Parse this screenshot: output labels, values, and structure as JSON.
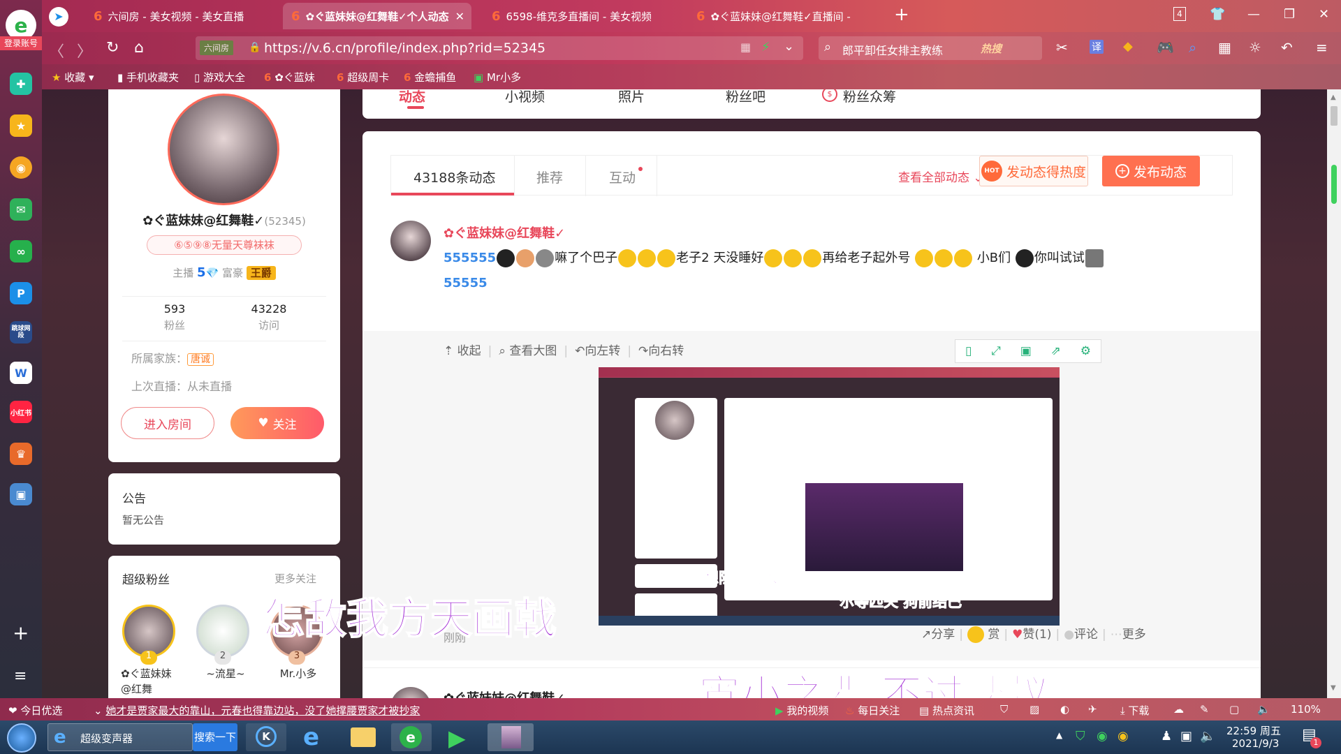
{
  "sidebar": {
    "login_label": "登录账号",
    "icons": [
      "browser-logo-icon",
      "plus-app-icon",
      "star-app-icon",
      "weibo-icon",
      "mail-icon",
      "link-icon",
      "p-app-icon",
      "game-app-icon",
      "doc-icon",
      "redbook-icon",
      "game-icon",
      "photo-icon"
    ],
    "redbook_label": "小红书",
    "game_label": "跳球网段",
    "add_label": "+",
    "menu_label": "≡"
  },
  "tabs": [
    {
      "label": "六间房 - 美女视频 - 美女直播",
      "active": false
    },
    {
      "label": "✿ぐ蓝妹妹@红舞鞋✓个人动态",
      "active": true
    },
    {
      "label": "6598-维克多直播间 - 美女视频",
      "active": false
    },
    {
      "label": "✿ぐ蓝妹妹@红舞鞋✓直播间 -",
      "active": false
    }
  ],
  "tab_count": "4",
  "navbar": {
    "site_tag": "六间房",
    "url": "https://v.6.cn/profile/index.php?rid=52345",
    "search_text": "郎平卸任女排主教练",
    "hot_label": "热搜"
  },
  "bookmarks": [
    "收藏",
    "手机收藏夹",
    "游戏大全",
    "✿ぐ蓝妹",
    "超级周卡",
    "金蟾捕鱼",
    "Mr小多"
  ],
  "profile": {
    "name": "✿ぐ蓝妹妹@红舞鞋✓",
    "rid": "(52345)",
    "badge": "⑥⑤⑨⑧无量天尊袜袜",
    "anchor_label": "主播",
    "anchor_level": "5",
    "rich_label": "富豪",
    "rich_level": "王爵",
    "fans_count": "593",
    "fans_label": "粉丝",
    "visit_count": "43228",
    "visit_label": "访问",
    "family_label": "所属家族：",
    "family_value": "唐诚",
    "last_live": "上次直播：从未直播",
    "enter_room": "进入房间",
    "follow": "关注"
  },
  "notice": {
    "title": "公告",
    "text": "暂无公告"
  },
  "super_fans": {
    "title": "超级粉丝",
    "more": "更多关注",
    "fans": [
      {
        "rank": "1",
        "name": "✿ぐ蓝妹妹@红舞"
      },
      {
        "rank": "2",
        "name": "~流星~"
      },
      {
        "rank": "3",
        "name": "Mr.小多"
      }
    ]
  },
  "top_nav": [
    "动态",
    "小视频",
    "照片",
    "粉丝吧",
    "粉丝众筹"
  ],
  "feed": {
    "tabs": [
      "43188条动态",
      "推荐",
      "互动"
    ],
    "view_all": "查看全部动态",
    "heat_button": "发动态得热度",
    "post_button": "发布动态",
    "hot_badge": "HOT",
    "post_author": "✿ぐ蓝妹妹@红舞鞋✓",
    "post_text_1": "嘛了个巴子",
    "post_text_2": "老子2 天没睡好",
    "post_text_3": "再给老子起外号",
    "post_text_4": "小B们",
    "post_text_5": "你叫试试",
    "img_tools": [
      "收起",
      "查看大图",
      "向左转",
      "向右转"
    ],
    "time": "刚刚",
    "actions": [
      "分享",
      "赏",
      "赞(1)",
      "评论",
      "更多"
    ],
    "next_author": "✿ぐ蓝妹妹@红舞鞋✓"
  },
  "screenshot_overlays": [
    "妄想阻挡我入城",
    "尔等匹夫 狗前结巴"
  ],
  "overlays": [
    "怎敌我方天画戟",
    "宵小之辈 不过蝼蚁"
  ],
  "statusbar": {
    "today": "今日优选",
    "news": "她才是贾家最大的靠山，元春也得靠边站，没了她撑腰贾家才被抄家",
    "my_video": "我的视频",
    "daily": "每日关注",
    "hot_news": "热点资讯",
    "download": "下载",
    "zoom": "110%"
  },
  "taskbar": {
    "app_label": "超级变声器",
    "search_btn": "搜索一下",
    "time": "22:59 周五",
    "date": "2021/9/3",
    "notif": "1"
  },
  "colors": {
    "accent": "#e8475a",
    "orange": "#ff7a45"
  }
}
